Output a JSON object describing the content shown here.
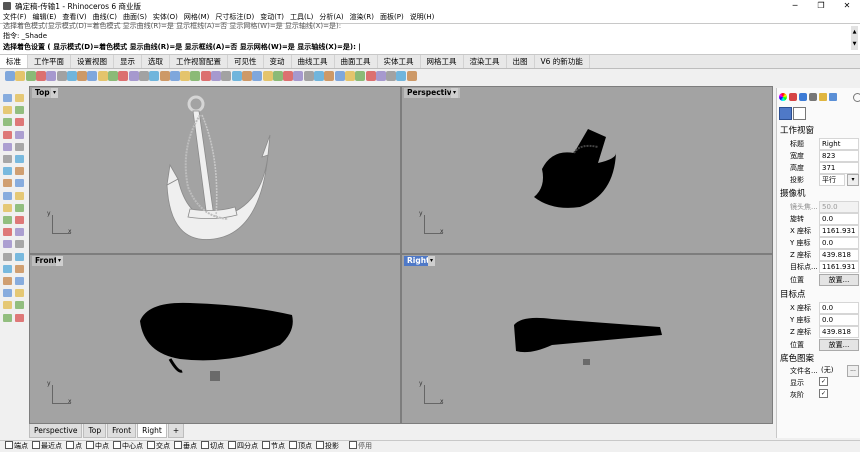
{
  "title": "确定稿-传输1 - Rhinoceros 6 商业版",
  "menu": [
    "文件(F)",
    "编辑(E)",
    "查看(V)",
    "曲线(C)",
    "曲面(S)",
    "实体(O)",
    "网格(M)",
    "尺寸标注(D)",
    "变动(T)",
    "工具(L)",
    "分析(A)",
    "渲染(R)",
    "面板(P)",
    "说明(H)"
  ],
  "command": {
    "history": "选择着色模式(显示模式(D)=着色模式 显示曲线(R)=是 显示框线(A)=否 显示网格(W)=是 显示轴线(X)=是):",
    "prompt": "指令: _Shade",
    "current": "选择着色设置 ( 显示模式(D)=着色模式 显示曲线(R)=是 显示框线(A)=否 显示网格(W)=是 显示轴线(X)=是): |"
  },
  "tabs": [
    "标准",
    "工作平面",
    "设置视图",
    "显示",
    "选取",
    "工作视窗配置",
    "可见性",
    "变动",
    "曲线工具",
    "曲面工具",
    "实体工具",
    "网格工具",
    "渲染工具",
    "出图",
    "V6 的新功能"
  ],
  "active_tab": "标准",
  "viewports": {
    "top": "Top",
    "perspective": "Perspective",
    "front": "Front",
    "right": "Right",
    "axis_x": "x",
    "axis_y": "y"
  },
  "viewport_tabs": [
    "Perspective",
    "Top",
    "Front",
    "Right"
  ],
  "add_tab": "+",
  "active_viewport": "Right",
  "panel": {
    "viewport_section": "工作视窗",
    "title_label": "标题",
    "title_value": "Right",
    "width_label": "宽度",
    "width_value": "823",
    "height_label": "高度",
    "height_value": "371",
    "projection_label": "投影",
    "projection_value": "平行",
    "camera_section": "摄像机",
    "lens_label": "镜头焦...",
    "lens_value": "50.0",
    "rotation_label": "旋转",
    "rotation_value": "0.0",
    "cam_x_label": "X 座标",
    "cam_x_value": "1161.931",
    "cam_y_label": "Y 座标",
    "cam_y_value": "0.0",
    "cam_z_label": "Z 座标",
    "cam_z_value": "439.818",
    "target_dist_label": "目标点...",
    "target_dist_value": "1161.931",
    "position_label": "位置",
    "place_button": "放置...",
    "target_section": "目标点",
    "tgt_x_label": "X 座标",
    "tgt_x_value": "0.0",
    "tgt_y_label": "Y 座标",
    "tgt_y_value": "0.0",
    "tgt_z_label": "Z 座标",
    "tgt_z_value": "439.818",
    "tgt_position_label": "位置",
    "tgt_place_button": "放置...",
    "bg_section": "底色图案",
    "file_label": "文件名...",
    "file_value": "(无)",
    "file_browse": "...",
    "show_label": "显示",
    "gray_label": "灰阶"
  },
  "snaps": [
    "端点",
    "最近点",
    "点",
    "中点",
    "中心点",
    "交点",
    "垂点",
    "切点",
    "四分点",
    "节点",
    "顶点",
    "投影"
  ],
  "snap_disable": "停用",
  "colors": {
    "accent": "#4f79c7",
    "viewport_bg": "#a3a3a3"
  }
}
